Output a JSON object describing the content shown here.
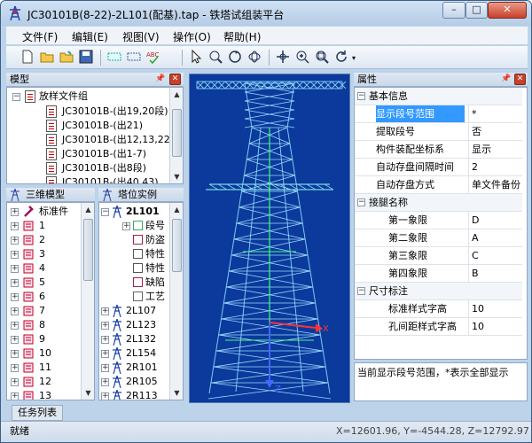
{
  "window": {
    "title": "JC30101B(8-22)-2L101(配基).tap - 铁塔试组装平台",
    "min": "–",
    "max": "□",
    "close": "✕"
  },
  "menu": [
    {
      "label": "文件(F)"
    },
    {
      "label": "编辑(E)"
    },
    {
      "label": "视图(V)"
    },
    {
      "label": "操作(O)"
    },
    {
      "label": "帮助(H)"
    }
  ],
  "toolbar": {
    "icons": [
      "new-file-icon",
      "open-folder-icon",
      "save-folder-icon",
      "save-disk-icon",
      "grid-icon",
      "dotted-rect-icon",
      "abc-check-icon",
      "pointer-icon",
      "zoom-window-icon",
      "rotate-icon",
      "rotate3d-icon",
      "pan-icon",
      "zoom-in-icon",
      "zoom-fit-icon",
      "refresh-icon"
    ]
  },
  "model_panel": {
    "title": "模型",
    "root": "放样文件组",
    "files": [
      "JC30101B-(出19,20段)",
      "JC30101B-(出21)",
      "JC30101B-(出12,13,22",
      "JC30101B-(出1-7)",
      "JC30101B-(出8段)",
      "JC30101B-(出40,43)"
    ]
  },
  "tree3d": {
    "title": "三维模型",
    "items": [
      "标准件",
      "1",
      "2",
      "3",
      "4",
      "5",
      "6",
      "7",
      "8",
      "9",
      "10",
      "11",
      "12",
      "13"
    ]
  },
  "towers": {
    "title": "塔位实例",
    "root": "2L101",
    "children": [
      "段号",
      "防盗",
      "特性",
      "特性",
      "缺陷",
      "工艺"
    ],
    "list": [
      "2L107",
      "2L123",
      "2L132",
      "2L154",
      "2R101",
      "2R105",
      "2R113"
    ]
  },
  "viewport": {
    "axis_x": "X",
    "axis_z": "Z"
  },
  "props": {
    "title": "属性",
    "groups": [
      {
        "name": "基本信息",
        "rows": [
          [
            "显示段号范围",
            "*"
          ],
          [
            "提取段号",
            "否"
          ],
          [
            "构件装配坐标系",
            "显示"
          ],
          [
            "自动存盘间隔时间",
            "2"
          ],
          [
            "自动存盘方式",
            "单文件备份"
          ]
        ]
      },
      {
        "name": "接腿名称",
        "rows": [
          [
            "第一象限",
            "D"
          ],
          [
            "第二象限",
            "A"
          ],
          [
            "第三象限",
            "C"
          ],
          [
            "第四象限",
            "B"
          ]
        ]
      },
      {
        "name": "尺寸标注",
        "rows": [
          [
            "标准样式字高",
            "10"
          ],
          [
            "孔间距样式字高",
            "10"
          ]
        ]
      }
    ],
    "description": "当前显示段号范围，*表示全部显示"
  },
  "taskbar": {
    "tab": "任务列表"
  },
  "status": {
    "text": "就绪",
    "coords": "X=12601.96, Y=-4544.28, Z=12792.97"
  },
  "colors": {
    "viewport_bg": "#0b3a9c",
    "selection": "#3399ff",
    "tower_lines": "#7ec8f0"
  }
}
